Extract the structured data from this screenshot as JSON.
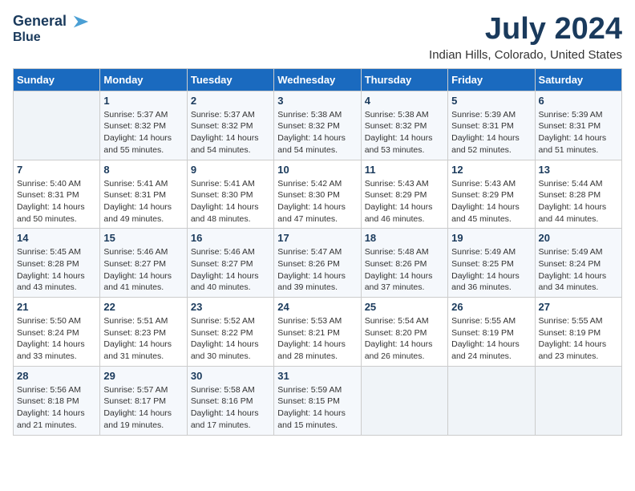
{
  "header": {
    "logo_line1": "General",
    "logo_line2": "Blue",
    "month_title": "July 2024",
    "location": "Indian Hills, Colorado, United States"
  },
  "days_of_week": [
    "Sunday",
    "Monday",
    "Tuesday",
    "Wednesday",
    "Thursday",
    "Friday",
    "Saturday"
  ],
  "weeks": [
    [
      {
        "day": "",
        "info": ""
      },
      {
        "day": "1",
        "info": "Sunrise: 5:37 AM\nSunset: 8:32 PM\nDaylight: 14 hours\nand 55 minutes."
      },
      {
        "day": "2",
        "info": "Sunrise: 5:37 AM\nSunset: 8:32 PM\nDaylight: 14 hours\nand 54 minutes."
      },
      {
        "day": "3",
        "info": "Sunrise: 5:38 AM\nSunset: 8:32 PM\nDaylight: 14 hours\nand 54 minutes."
      },
      {
        "day": "4",
        "info": "Sunrise: 5:38 AM\nSunset: 8:32 PM\nDaylight: 14 hours\nand 53 minutes."
      },
      {
        "day": "5",
        "info": "Sunrise: 5:39 AM\nSunset: 8:31 PM\nDaylight: 14 hours\nand 52 minutes."
      },
      {
        "day": "6",
        "info": "Sunrise: 5:39 AM\nSunset: 8:31 PM\nDaylight: 14 hours\nand 51 minutes."
      }
    ],
    [
      {
        "day": "7",
        "info": "Sunrise: 5:40 AM\nSunset: 8:31 PM\nDaylight: 14 hours\nand 50 minutes."
      },
      {
        "day": "8",
        "info": "Sunrise: 5:41 AM\nSunset: 8:31 PM\nDaylight: 14 hours\nand 49 minutes."
      },
      {
        "day": "9",
        "info": "Sunrise: 5:41 AM\nSunset: 8:30 PM\nDaylight: 14 hours\nand 48 minutes."
      },
      {
        "day": "10",
        "info": "Sunrise: 5:42 AM\nSunset: 8:30 PM\nDaylight: 14 hours\nand 47 minutes."
      },
      {
        "day": "11",
        "info": "Sunrise: 5:43 AM\nSunset: 8:29 PM\nDaylight: 14 hours\nand 46 minutes."
      },
      {
        "day": "12",
        "info": "Sunrise: 5:43 AM\nSunset: 8:29 PM\nDaylight: 14 hours\nand 45 minutes."
      },
      {
        "day": "13",
        "info": "Sunrise: 5:44 AM\nSunset: 8:28 PM\nDaylight: 14 hours\nand 44 minutes."
      }
    ],
    [
      {
        "day": "14",
        "info": "Sunrise: 5:45 AM\nSunset: 8:28 PM\nDaylight: 14 hours\nand 43 minutes."
      },
      {
        "day": "15",
        "info": "Sunrise: 5:46 AM\nSunset: 8:27 PM\nDaylight: 14 hours\nand 41 minutes."
      },
      {
        "day": "16",
        "info": "Sunrise: 5:46 AM\nSunset: 8:27 PM\nDaylight: 14 hours\nand 40 minutes."
      },
      {
        "day": "17",
        "info": "Sunrise: 5:47 AM\nSunset: 8:26 PM\nDaylight: 14 hours\nand 39 minutes."
      },
      {
        "day": "18",
        "info": "Sunrise: 5:48 AM\nSunset: 8:26 PM\nDaylight: 14 hours\nand 37 minutes."
      },
      {
        "day": "19",
        "info": "Sunrise: 5:49 AM\nSunset: 8:25 PM\nDaylight: 14 hours\nand 36 minutes."
      },
      {
        "day": "20",
        "info": "Sunrise: 5:49 AM\nSunset: 8:24 PM\nDaylight: 14 hours\nand 34 minutes."
      }
    ],
    [
      {
        "day": "21",
        "info": "Sunrise: 5:50 AM\nSunset: 8:24 PM\nDaylight: 14 hours\nand 33 minutes."
      },
      {
        "day": "22",
        "info": "Sunrise: 5:51 AM\nSunset: 8:23 PM\nDaylight: 14 hours\nand 31 minutes."
      },
      {
        "day": "23",
        "info": "Sunrise: 5:52 AM\nSunset: 8:22 PM\nDaylight: 14 hours\nand 30 minutes."
      },
      {
        "day": "24",
        "info": "Sunrise: 5:53 AM\nSunset: 8:21 PM\nDaylight: 14 hours\nand 28 minutes."
      },
      {
        "day": "25",
        "info": "Sunrise: 5:54 AM\nSunset: 8:20 PM\nDaylight: 14 hours\nand 26 minutes."
      },
      {
        "day": "26",
        "info": "Sunrise: 5:55 AM\nSunset: 8:19 PM\nDaylight: 14 hours\nand 24 minutes."
      },
      {
        "day": "27",
        "info": "Sunrise: 5:55 AM\nSunset: 8:19 PM\nDaylight: 14 hours\nand 23 minutes."
      }
    ],
    [
      {
        "day": "28",
        "info": "Sunrise: 5:56 AM\nSunset: 8:18 PM\nDaylight: 14 hours\nand 21 minutes."
      },
      {
        "day": "29",
        "info": "Sunrise: 5:57 AM\nSunset: 8:17 PM\nDaylight: 14 hours\nand 19 minutes."
      },
      {
        "day": "30",
        "info": "Sunrise: 5:58 AM\nSunset: 8:16 PM\nDaylight: 14 hours\nand 17 minutes."
      },
      {
        "day": "31",
        "info": "Sunrise: 5:59 AM\nSunset: 8:15 PM\nDaylight: 14 hours\nand 15 minutes."
      },
      {
        "day": "",
        "info": ""
      },
      {
        "day": "",
        "info": ""
      },
      {
        "day": "",
        "info": ""
      }
    ]
  ]
}
